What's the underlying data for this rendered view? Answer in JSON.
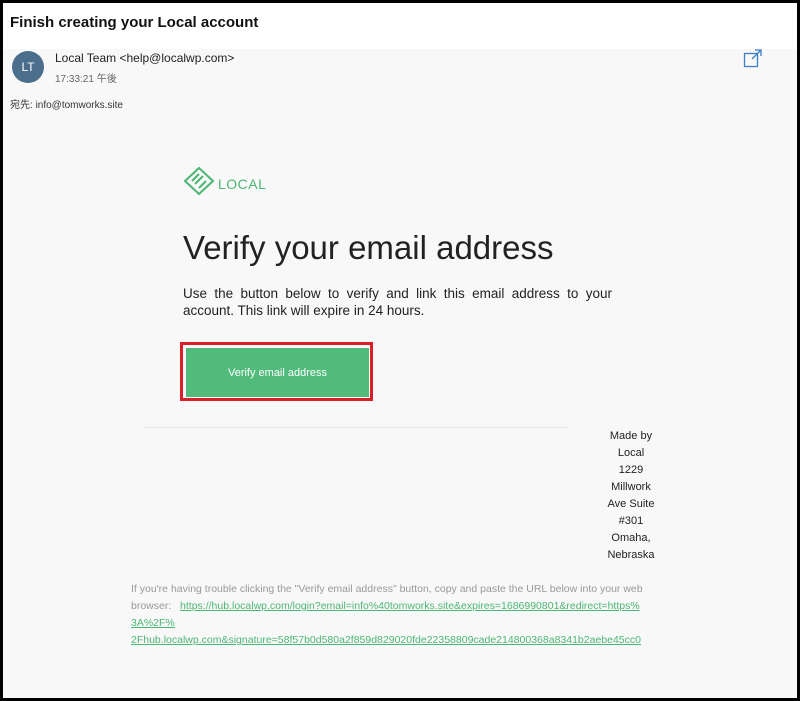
{
  "email": {
    "subject": "Finish creating your Local account",
    "avatar_initials": "LT",
    "sender": "Local Team <help@localwp.com>",
    "time": "17:33:21 午後",
    "recipient_label": "宛先:",
    "recipient": "info@tomworks.site",
    "popout_icon": "popout-icon"
  },
  "content": {
    "logo_text": "LOCAL",
    "brand_color": "#4bb673",
    "headline": "Verify your email address",
    "body": "Use the button below to verify and link this email address to your account. This link will expire in 24 hours.",
    "button_label": "Verify email address",
    "button_color": "#51bb7b",
    "highlight_color": "#d9202a",
    "address_lines": [
      "Made by",
      "Local",
      "1229",
      "Millwork",
      "Ave Suite",
      "#301",
      "Omaha,",
      "Nebraska"
    ],
    "trouble_text": "If you're having trouble clicking the \"Verify email address\" button, copy and paste the URL below into your web browser:",
    "url_lines": [
      "https://hub.localwp.com/login?email=info%40tomworks.site&expires=1686990801&redirect=https%",
      "3A%2F%",
      "2Fhub.localwp.com&signature=58f57b0d580a2f859d829020fde22358809cade214800368a8341b2aebe45cc0"
    ]
  }
}
